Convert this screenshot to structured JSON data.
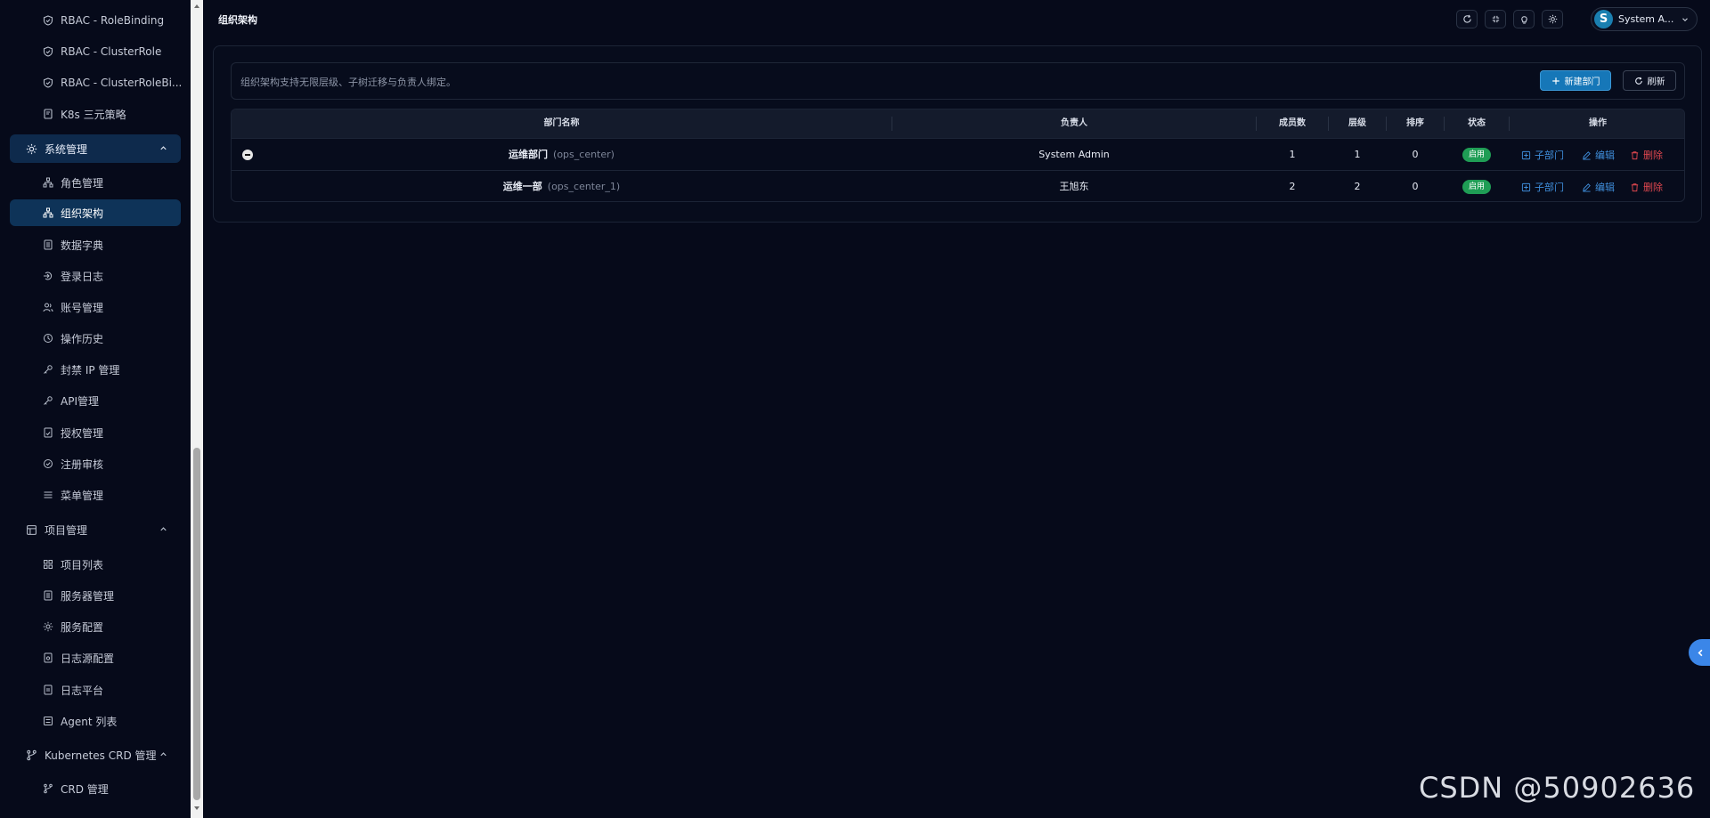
{
  "sidebar": {
    "items_top": [
      {
        "label": "RBAC - RoleBinding",
        "icon": "shield-icon"
      },
      {
        "label": "RBAC - ClusterRole",
        "icon": "shield-icon"
      },
      {
        "label": "RBAC - ClusterRoleBi...",
        "icon": "shield-icon"
      },
      {
        "label": "K8s 三元策略",
        "icon": "policy-doc-icon"
      }
    ],
    "group_system": {
      "label": "系统管理",
      "icon": "gear-icon"
    },
    "system_items": [
      {
        "label": "角色管理",
        "icon": "hierarchy-icon"
      },
      {
        "label": "组织架构",
        "icon": "org-tree-icon"
      },
      {
        "label": "数据字典",
        "icon": "book-icon"
      },
      {
        "label": "登录日志",
        "icon": "login-icon"
      },
      {
        "label": "账号管理",
        "icon": "users-icon"
      },
      {
        "label": "操作历史",
        "icon": "history-icon"
      },
      {
        "label": "封禁 IP 管理",
        "icon": "key-icon"
      },
      {
        "label": "API管理",
        "icon": "key-icon"
      },
      {
        "label": "授权管理",
        "icon": "auth-doc-icon"
      },
      {
        "label": "注册审核",
        "icon": "check-circle-icon"
      },
      {
        "label": "菜单管理",
        "icon": "menu-icon"
      }
    ],
    "group_project": {
      "label": "项目管理",
      "icon": "project-icon"
    },
    "project_items": [
      {
        "label": "项目列表",
        "icon": "grid-icon"
      },
      {
        "label": "服务器管理",
        "icon": "server-icon"
      },
      {
        "label": "服务配置",
        "icon": "gear-icon"
      },
      {
        "label": "日志源配置",
        "icon": "log-source-icon"
      },
      {
        "label": "日志平台",
        "icon": "log-doc-icon"
      },
      {
        "label": "Agent 列表",
        "icon": "agent-icon"
      }
    ],
    "group_k8s": {
      "label": "Kubernetes CRD 管理",
      "icon": "branch-icon"
    },
    "k8s_items": [
      {
        "label": "CRD 管理",
        "icon": "branch-icon"
      }
    ]
  },
  "header": {
    "title": "组织架构",
    "user_initial": "S",
    "user_name": "System A..."
  },
  "notice": {
    "text": "组织架构支持无限层级、子树迁移与负责人绑定。",
    "new_button": "新建部门",
    "refresh_button": "刷新"
  },
  "table": {
    "columns": [
      "部门名称",
      "负责人",
      "成员数",
      "层级",
      "排序",
      "状态",
      "操作"
    ],
    "rows": [
      {
        "name": "运维部门",
        "code": "(ops_center)",
        "owner": "System Admin",
        "members": "1",
        "level": "1",
        "sort": "0",
        "status": "启用",
        "expanded": true
      },
      {
        "name": "运维一部",
        "code": "(ops_center_1)",
        "owner": "王旭东",
        "members": "2",
        "level": "2",
        "sort": "0",
        "status": "启用",
        "expanded": false
      }
    ],
    "actions": {
      "sub": "子部门",
      "edit": "编辑",
      "delete": "删除"
    }
  },
  "watermark": "CSDN @50902636",
  "colors": {
    "accent": "#1677b8",
    "status_enabled": "#1f9d55",
    "danger": "#e0474f",
    "link": "#3f8edb"
  }
}
